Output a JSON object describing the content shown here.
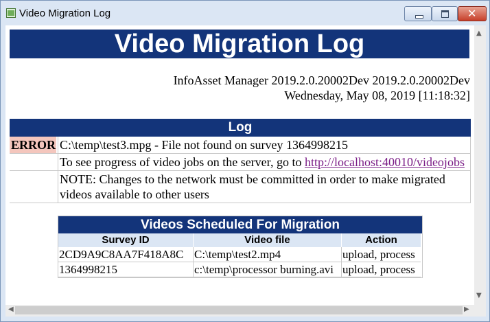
{
  "window": {
    "title": "Video Migration Log"
  },
  "page": {
    "banner": "Video Migration Log",
    "product_line": "InfoAsset Manager 2019.2.0.20002Dev 2019.2.0.20002Dev",
    "date_line": "Wednesday, May 08, 2019 [11:18:32]"
  },
  "log": {
    "header": "Log",
    "error_label": "ERROR",
    "error_text": "C:\\temp\\test3.mpg - File not found on survey 1364998215",
    "progress_text": "To see progress of video jobs on the server, go to ",
    "progress_link": "http://localhost:40010/videojobs",
    "note_text": "NOTE: Changes to the network must be committed in order to make migrated videos available to other users"
  },
  "videos": {
    "header": "Videos Scheduled For Migration",
    "columns": [
      "Survey ID",
      "Video file",
      "Action"
    ],
    "rows": [
      [
        "2CD9A9C8AA7F418A8C",
        "C:\\temp\\test2.mp4",
        "upload, process"
      ],
      [
        "1364998215",
        "c:\\temp\\processor burning.avi",
        "upload, process"
      ]
    ]
  }
}
